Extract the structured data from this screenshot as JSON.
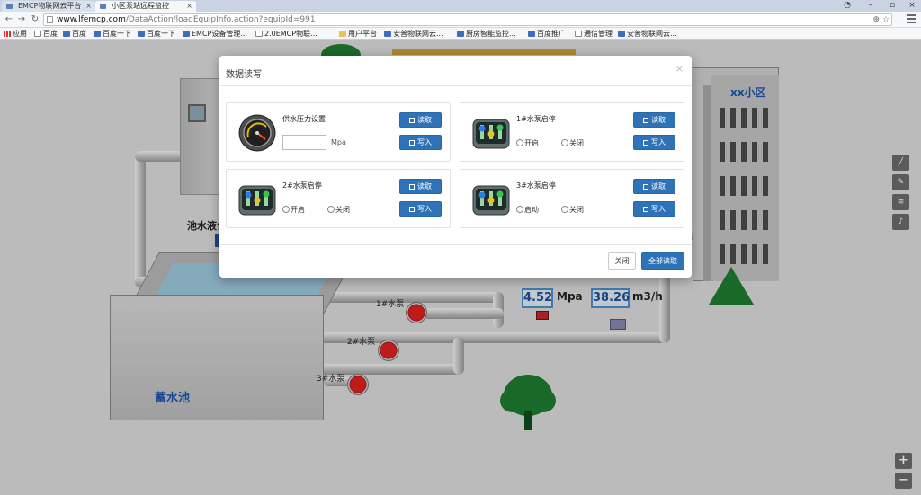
{
  "browser": {
    "tabs": [
      {
        "title": "EMCP物联网云平台",
        "active": false
      },
      {
        "title": "小区泵站远程监控",
        "active": true
      }
    ],
    "url_host": "www.lfemcp.com",
    "url_path": "/DataAction/loadEquipInfo.action?equipId=991",
    "bookmarks": [
      "应用",
      "百度",
      "百度",
      "百度一下",
      "百度一下",
      "EMCP设备管理...",
      "2.0EMCP物联...",
      "用户平台",
      "安普物联网云...",
      "厨房智能监控...",
      "百度推广",
      "通信管理",
      "安普物联网云..."
    ]
  },
  "scene": {
    "building_label": "xx小区",
    "tank_label": "蓄水池",
    "level_label": "池水液位",
    "pumps": [
      "1#水泵",
      "2#水泵",
      "3#水泵"
    ],
    "pressure_value": "4.52",
    "pressure_unit": "Mpa",
    "flow_value": "38.26",
    "flow_unit": "m3/h"
  },
  "modal": {
    "title": "数据读写",
    "close_icon": "×",
    "read_label": "读取",
    "write_label": "写入",
    "cards": [
      {
        "title": "供水压力设置",
        "unit": "Mpa",
        "input_value": ""
      },
      {
        "title": "1#水泵启停",
        "radio_on": "开启",
        "radio_off": "关闭"
      },
      {
        "title": "2#水泵启停",
        "radio_on": "开启",
        "radio_off": "关闭"
      },
      {
        "title": "3#水泵启停",
        "radio_on": "启动",
        "radio_off": "关闭"
      }
    ],
    "footer_close": "关闭",
    "footer_read_all": "全部读取"
  },
  "colors": {
    "accent": "#2e73b8",
    "tree": "#1e7d2f",
    "pump": "#e12020"
  }
}
